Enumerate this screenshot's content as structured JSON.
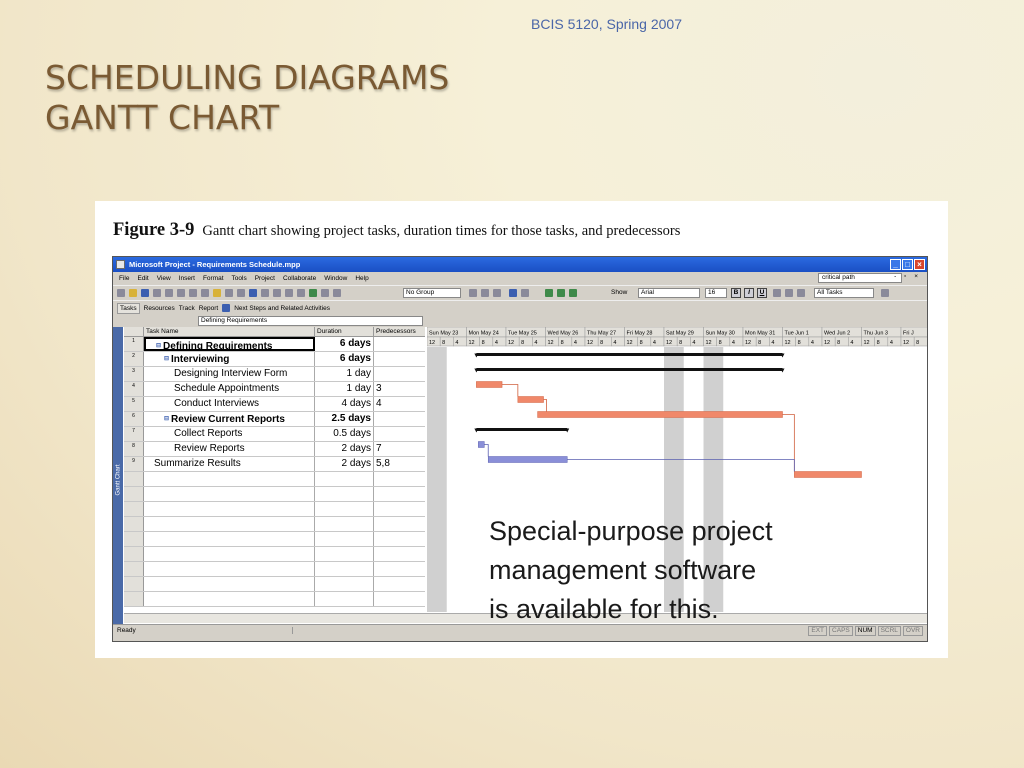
{
  "slide": {
    "course": "BCIS 5120, Spring 2007",
    "title_line1": "SCHEDULING DIAGRAMS",
    "title_line2": "GANTT CHART",
    "note_line1": "Special-purpose project",
    "note_line2": "management software",
    "note_line3": "is available for this."
  },
  "figure": {
    "number": "Figure 3-9",
    "caption": "Gantt chart showing project tasks, duration times for those tasks, and predecessors"
  },
  "app": {
    "window_title": "Microsoft Project - Requirements Schedule.mpp",
    "menu": [
      "File",
      "Edit",
      "View",
      "Insert",
      "Format",
      "Tools",
      "Project",
      "Collaborate",
      "Window",
      "Help"
    ],
    "filter_value": "critical path",
    "group_combo": "No Group",
    "font_combo": "Arial",
    "size_combo": "16",
    "tasks_filter": "All Tasks",
    "show_label": "Show",
    "toolbar2": [
      "Tasks",
      "Resources",
      "Track",
      "Report"
    ],
    "next_steps": "Next Steps and Related Activities",
    "entry_value": "Defining Requirements",
    "view_bar_label": "Gantt Chart",
    "status_ready": "Ready",
    "status_keys": [
      "EXT",
      "CAPS",
      "NUM",
      "SCRL",
      "OVR"
    ],
    "columns": {
      "name": "Task Name",
      "duration": "Duration",
      "pred": "Predecessors"
    },
    "tasks": [
      {
        "id": "1",
        "name": "Defining Requirements",
        "duration": "6 days",
        "pred": "",
        "level": 0,
        "summary": true
      },
      {
        "id": "2",
        "name": "Interviewing",
        "duration": "6 days",
        "pred": "",
        "level": 1,
        "summary": true
      },
      {
        "id": "3",
        "name": "Designing Interview Form",
        "duration": "1 day",
        "pred": "",
        "level": 2,
        "summary": false
      },
      {
        "id": "4",
        "name": "Schedule Appointments",
        "duration": "1 day",
        "pred": "3",
        "level": 2,
        "summary": false
      },
      {
        "id": "5",
        "name": "Conduct Interviews",
        "duration": "4 days",
        "pred": "4",
        "level": 2,
        "summary": false
      },
      {
        "id": "6",
        "name": "Review Current Reports",
        "duration": "2.5 days",
        "pred": "",
        "level": 1,
        "summary": true
      },
      {
        "id": "7",
        "name": "Collect Reports",
        "duration": "0.5 days",
        "pred": "",
        "level": 2,
        "summary": false
      },
      {
        "id": "8",
        "name": "Review Reports",
        "duration": "2 days",
        "pred": "7",
        "level": 2,
        "summary": false
      },
      {
        "id": "9",
        "name": "Summarize Results",
        "duration": "2 days",
        "pred": "5,8",
        "level": 0,
        "summary": false
      }
    ],
    "timescale_days": [
      "Sun May 23",
      "Mon May 24",
      "Tue May 25",
      "Wed May 26",
      "Thu May 27",
      "Fri May 28",
      "Sat May 29",
      "Sun May 30",
      "Mon May 31",
      "Tue Jun 1",
      "Wed Jun 2",
      "Thu Jun 3",
      "Fri J"
    ],
    "timescale_hours": [
      "12",
      "8",
      "4"
    ],
    "bars": [
      {
        "task": "1",
        "start": 1.25,
        "end": 9.0,
        "kind": "summary"
      },
      {
        "task": "2",
        "start": 1.25,
        "end": 9.0,
        "kind": "summary"
      },
      {
        "task": "3",
        "start": 1.25,
        "end": 1.9,
        "kind": "critical"
      },
      {
        "task": "4",
        "start": 2.3,
        "end": 2.95,
        "kind": "critical"
      },
      {
        "task": "5",
        "start": 2.8,
        "end": 9.0,
        "kind": "critical"
      },
      {
        "task": "6",
        "start": 1.25,
        "end": 3.55,
        "kind": "summary"
      },
      {
        "task": "7",
        "start": 1.3,
        "end": 1.45,
        "kind": "normal"
      },
      {
        "task": "8",
        "start": 1.55,
        "end": 3.55,
        "kind": "normal"
      },
      {
        "task": "9",
        "start": 9.3,
        "end": 11.0,
        "kind": "critical"
      }
    ],
    "colors": {
      "critical": "#f0886a",
      "normal": "#8a8fd8",
      "summary": "#111111",
      "weekend": "#d0d0d0"
    }
  }
}
